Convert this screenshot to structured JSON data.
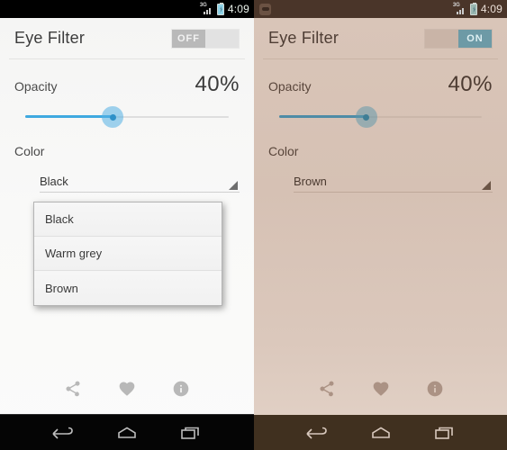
{
  "app": {
    "title": "Eye Filter"
  },
  "colors": {
    "accent_blue": "#3fa9e0",
    "accent_blue_right": "#4e8ca6",
    "switch_on": "#6d9aa6",
    "switch_off_thumb": "#b9b9b9",
    "left_bg": "#f8f8f7",
    "right_bg": "#d9c5b8",
    "nav_left": "#050505",
    "nav_right": "#40301f"
  },
  "left_phone": {
    "statusbar": {
      "network_label": "3G",
      "clock": "4:09",
      "signal_icon": "signal-3g-icon",
      "battery_icon": "battery-charging-icon"
    },
    "title": "Eye Filter",
    "toggle": {
      "state": "off",
      "label": "OFF"
    },
    "opacity": {
      "label": "Opacity",
      "value": "40%",
      "percent": 40
    },
    "color": {
      "label": "Color",
      "selected": "Black"
    },
    "dropdown": {
      "open": true,
      "options": [
        {
          "label": "Black"
        },
        {
          "label": "Warm grey"
        },
        {
          "label": "Brown"
        }
      ]
    },
    "actions": [
      {
        "name": "share-icon",
        "label": "Share"
      },
      {
        "name": "heart-icon",
        "label": "Favorite"
      },
      {
        "name": "info-icon",
        "label": "Info"
      }
    ],
    "navbar": [
      {
        "name": "back-icon",
        "label": "Back"
      },
      {
        "name": "home-icon",
        "label": "Home"
      },
      {
        "name": "recents-icon",
        "label": "Recents"
      }
    ]
  },
  "right_phone": {
    "statusbar": {
      "notification_icon": "eye-filter-notification-icon",
      "network_label": "3G",
      "clock": "4:09",
      "signal_icon": "signal-3g-icon",
      "battery_icon": "battery-charging-icon"
    },
    "title": "Eye Filter",
    "toggle": {
      "state": "on",
      "label": "ON"
    },
    "opacity": {
      "label": "Opacity",
      "value": "40%",
      "percent": 40
    },
    "color": {
      "label": "Color",
      "selected": "Brown"
    },
    "actions": [
      {
        "name": "share-icon",
        "label": "Share"
      },
      {
        "name": "heart-icon",
        "label": "Favorite"
      },
      {
        "name": "info-icon",
        "label": "Info"
      }
    ],
    "navbar": [
      {
        "name": "back-icon",
        "label": "Back"
      },
      {
        "name": "home-icon",
        "label": "Home"
      },
      {
        "name": "recents-icon",
        "label": "Recents"
      }
    ]
  }
}
